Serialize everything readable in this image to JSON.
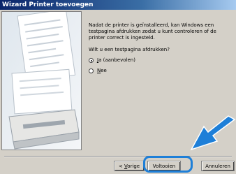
{
  "window": {
    "title": "Wizard Printer toevoegen"
  },
  "content": {
    "message": "Nadat de printer is geïnstalleerd, kan Windows een testpagina afdrukken zodat u kunt controleren of de printer correct is ingesteld.",
    "question": "Wilt u een testpagina afdrukken?",
    "options": [
      {
        "accel": "J",
        "rest": "a (aanbevolen)",
        "selected": true
      },
      {
        "accel": "N",
        "rest": "ee",
        "selected": false
      }
    ]
  },
  "buttons": {
    "back_prefix": "< ",
    "back_accel": "V",
    "back_rest": "orige",
    "finish": "Voltooien",
    "cancel": "Annuleren"
  },
  "colors": {
    "titlebar_start": "#0a246a",
    "highlight": "#1e7fd8",
    "arrow": "#1e7fd8"
  },
  "icons": {
    "illustration": "printer-with-paper-illustration",
    "arrow": "pointer-arrow-icon"
  }
}
